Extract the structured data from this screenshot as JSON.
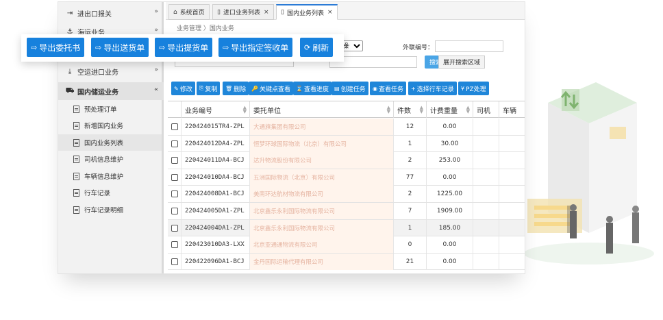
{
  "sidebar": {
    "items": [
      {
        "label": "进出口报关",
        "icon": "sign-in-icon",
        "chev": "»"
      },
      {
        "label": "海运业务",
        "icon": "ship-icon",
        "chev": "»"
      },
      {
        "label": "空运进口业务",
        "icon": "download-icon",
        "chev": "»"
      },
      {
        "label": "国内储运业务",
        "icon": "truck-icon",
        "chev": "«"
      }
    ],
    "subitems": [
      "预处理订单",
      "新增国内业务",
      "国内业务列表",
      "司机信息维护",
      "车辆信息维护",
      "行车记录",
      "行车记录明细"
    ]
  },
  "tabs": [
    {
      "label": "系统首页",
      "icon": "home-icon"
    },
    {
      "label": "进口业务列表",
      "icon": "doc-icon"
    },
    {
      "label": "国内业务列表",
      "icon": "doc-icon"
    }
  ],
  "tab_close": "×",
  "breadcrumb": "业务管理 〉国内业务",
  "search": {
    "select_value": "操作",
    "ext_no_label": "外联编号：",
    "search_button": "搜索",
    "expand_button": "展开搜索区域"
  },
  "toolbar": [
    {
      "glyph": "✎",
      "label": "修改"
    },
    {
      "glyph": "⎘",
      "label": "复制"
    },
    {
      "glyph": "🗑",
      "label": "删除"
    },
    {
      "glyph": "🔑",
      "label": "关键点查看"
    },
    {
      "glyph": "⌛",
      "label": "查看进度"
    },
    {
      "glyph": "▤",
      "label": "创建任务"
    },
    {
      "glyph": "◉",
      "label": "查看任务"
    },
    {
      "glyph": "+",
      "label": "选择行车记录"
    },
    {
      "glyph": "¥",
      "label": "PZ处理"
    }
  ],
  "export_bar": [
    {
      "glyph": "⇨",
      "label": "导出委托书"
    },
    {
      "glyph": "⇨",
      "label": "导出送货单"
    },
    {
      "glyph": "⇨",
      "label": "导出提货单"
    },
    {
      "glyph": "⇨",
      "label": "导出指定签收单"
    },
    {
      "glyph": "⟳",
      "label": "刷新"
    }
  ],
  "table": {
    "columns": [
      "业务编号",
      "委托单位",
      "件数",
      "计费重量",
      "司机",
      "车辆"
    ],
    "rows": [
      {
        "code": "220424015TR4-ZPL",
        "client": "大通旗集团有限公司",
        "count": "12",
        "weight": "0.00"
      },
      {
        "code": "220424012DA4-ZPL",
        "client": "恒梦环球国际物流（北京）有限公司",
        "count": "1",
        "weight": "30.00"
      },
      {
        "code": "220424011DA4-BCJ",
        "client": "达升物流股份有限公司",
        "count": "2",
        "weight": "253.00"
      },
      {
        "code": "220424010DA4-BCJ",
        "client": "五洲国际物流（北京）有限公司",
        "count": "77",
        "weight": "0.00"
      },
      {
        "code": "220424008DA1-BCJ",
        "client": "美南环达航材物流有限公司",
        "count": "2",
        "weight": "1225.00"
      },
      {
        "code": "220424005DA1-ZPL",
        "client": "北京鑫乐永利国际物流有限公司",
        "count": "7",
        "weight": "1909.00"
      },
      {
        "code": "220424004DA1-ZPL",
        "client": "北京鑫乐永利国际物流有限公司",
        "count": "1",
        "weight": "185.00"
      },
      {
        "code": "220423010DA3-LXX",
        "client": "北京亚通通物流有限公司",
        "count": "0",
        "weight": "0.00"
      },
      {
        "code": "220422096DA1-BCJ",
        "client": "金丹国际运输代理有限公司",
        "count": "21",
        "weight": "0.00"
      }
    ],
    "highlight_row": 6
  },
  "colors": {
    "primary": "#1781dd",
    "toolbar": "#1f86d9",
    "accent_tab": "#2b7bd6"
  }
}
